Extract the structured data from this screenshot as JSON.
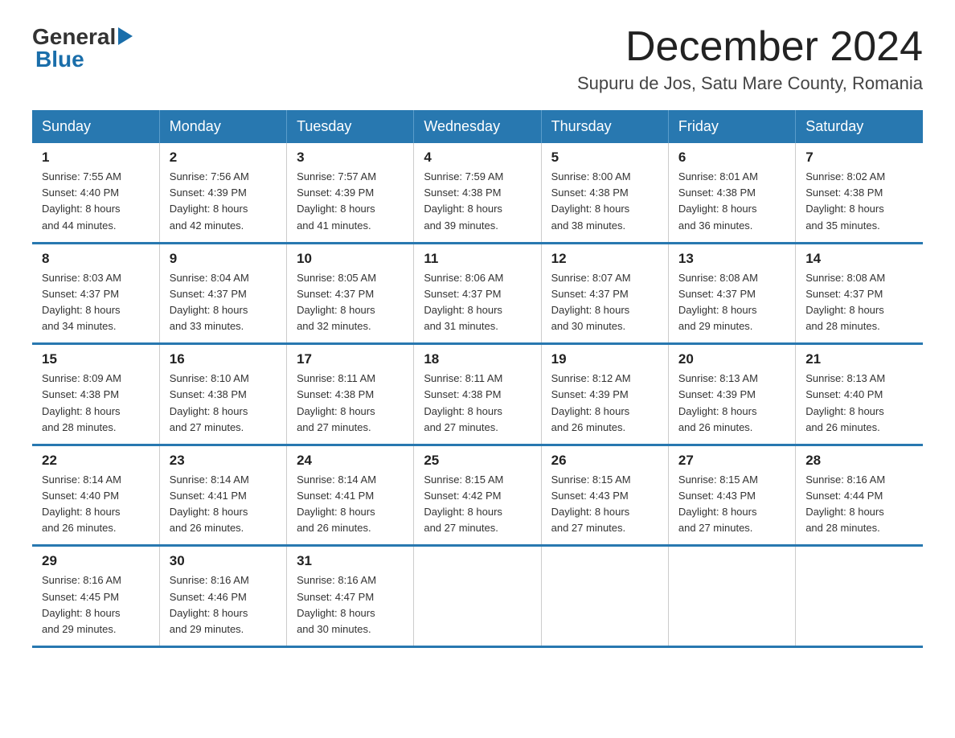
{
  "logo": {
    "general": "General",
    "blue": "Blue",
    "arrow": "▶"
  },
  "header": {
    "month_year": "December 2024",
    "location": "Supuru de Jos, Satu Mare County, Romania"
  },
  "days_of_week": [
    "Sunday",
    "Monday",
    "Tuesday",
    "Wednesday",
    "Thursday",
    "Friday",
    "Saturday"
  ],
  "weeks": [
    [
      {
        "day": "1",
        "sunrise": "7:55 AM",
        "sunset": "4:40 PM",
        "daylight": "8 hours and 44 minutes."
      },
      {
        "day": "2",
        "sunrise": "7:56 AM",
        "sunset": "4:39 PM",
        "daylight": "8 hours and 42 minutes."
      },
      {
        "day": "3",
        "sunrise": "7:57 AM",
        "sunset": "4:39 PM",
        "daylight": "8 hours and 41 minutes."
      },
      {
        "day": "4",
        "sunrise": "7:59 AM",
        "sunset": "4:38 PM",
        "daylight": "8 hours and 39 minutes."
      },
      {
        "day": "5",
        "sunrise": "8:00 AM",
        "sunset": "4:38 PM",
        "daylight": "8 hours and 38 minutes."
      },
      {
        "day": "6",
        "sunrise": "8:01 AM",
        "sunset": "4:38 PM",
        "daylight": "8 hours and 36 minutes."
      },
      {
        "day": "7",
        "sunrise": "8:02 AM",
        "sunset": "4:38 PM",
        "daylight": "8 hours and 35 minutes."
      }
    ],
    [
      {
        "day": "8",
        "sunrise": "8:03 AM",
        "sunset": "4:37 PM",
        "daylight": "8 hours and 34 minutes."
      },
      {
        "day": "9",
        "sunrise": "8:04 AM",
        "sunset": "4:37 PM",
        "daylight": "8 hours and 33 minutes."
      },
      {
        "day": "10",
        "sunrise": "8:05 AM",
        "sunset": "4:37 PM",
        "daylight": "8 hours and 32 minutes."
      },
      {
        "day": "11",
        "sunrise": "8:06 AM",
        "sunset": "4:37 PM",
        "daylight": "8 hours and 31 minutes."
      },
      {
        "day": "12",
        "sunrise": "8:07 AM",
        "sunset": "4:37 PM",
        "daylight": "8 hours and 30 minutes."
      },
      {
        "day": "13",
        "sunrise": "8:08 AM",
        "sunset": "4:37 PM",
        "daylight": "8 hours and 29 minutes."
      },
      {
        "day": "14",
        "sunrise": "8:08 AM",
        "sunset": "4:37 PM",
        "daylight": "8 hours and 28 minutes."
      }
    ],
    [
      {
        "day": "15",
        "sunrise": "8:09 AM",
        "sunset": "4:38 PM",
        "daylight": "8 hours and 28 minutes."
      },
      {
        "day": "16",
        "sunrise": "8:10 AM",
        "sunset": "4:38 PM",
        "daylight": "8 hours and 27 minutes."
      },
      {
        "day": "17",
        "sunrise": "8:11 AM",
        "sunset": "4:38 PM",
        "daylight": "8 hours and 27 minutes."
      },
      {
        "day": "18",
        "sunrise": "8:11 AM",
        "sunset": "4:38 PM",
        "daylight": "8 hours and 27 minutes."
      },
      {
        "day": "19",
        "sunrise": "8:12 AM",
        "sunset": "4:39 PM",
        "daylight": "8 hours and 26 minutes."
      },
      {
        "day": "20",
        "sunrise": "8:13 AM",
        "sunset": "4:39 PM",
        "daylight": "8 hours and 26 minutes."
      },
      {
        "day": "21",
        "sunrise": "8:13 AM",
        "sunset": "4:40 PM",
        "daylight": "8 hours and 26 minutes."
      }
    ],
    [
      {
        "day": "22",
        "sunrise": "8:14 AM",
        "sunset": "4:40 PM",
        "daylight": "8 hours and 26 minutes."
      },
      {
        "day": "23",
        "sunrise": "8:14 AM",
        "sunset": "4:41 PM",
        "daylight": "8 hours and 26 minutes."
      },
      {
        "day": "24",
        "sunrise": "8:14 AM",
        "sunset": "4:41 PM",
        "daylight": "8 hours and 26 minutes."
      },
      {
        "day": "25",
        "sunrise": "8:15 AM",
        "sunset": "4:42 PM",
        "daylight": "8 hours and 27 minutes."
      },
      {
        "day": "26",
        "sunrise": "8:15 AM",
        "sunset": "4:43 PM",
        "daylight": "8 hours and 27 minutes."
      },
      {
        "day": "27",
        "sunrise": "8:15 AM",
        "sunset": "4:43 PM",
        "daylight": "8 hours and 27 minutes."
      },
      {
        "day": "28",
        "sunrise": "8:16 AM",
        "sunset": "4:44 PM",
        "daylight": "8 hours and 28 minutes."
      }
    ],
    [
      {
        "day": "29",
        "sunrise": "8:16 AM",
        "sunset": "4:45 PM",
        "daylight": "8 hours and 29 minutes."
      },
      {
        "day": "30",
        "sunrise": "8:16 AM",
        "sunset": "4:46 PM",
        "daylight": "8 hours and 29 minutes."
      },
      {
        "day": "31",
        "sunrise": "8:16 AM",
        "sunset": "4:47 PM",
        "daylight": "8 hours and 30 minutes."
      },
      null,
      null,
      null,
      null
    ]
  ],
  "labels": {
    "sunrise": "Sunrise:",
    "sunset": "Sunset:",
    "daylight": "Daylight:"
  }
}
